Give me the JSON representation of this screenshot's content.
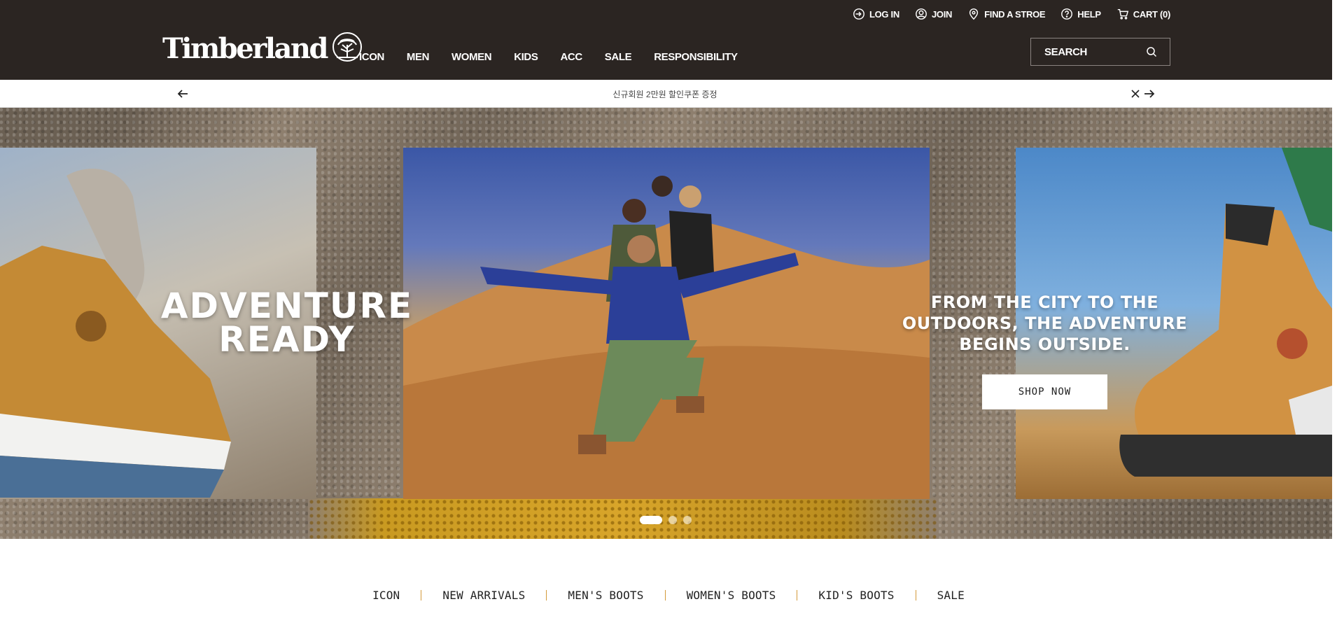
{
  "header": {
    "utility_links": [
      {
        "label": "LOG IN",
        "icon": "login-icon"
      },
      {
        "label": "JOIN",
        "icon": "user-icon"
      },
      {
        "label": "FIND A STROE",
        "icon": "location-pin-icon"
      },
      {
        "label": "HELP",
        "icon": "help-icon"
      },
      {
        "label": "CART (0)",
        "icon": "cart-icon"
      }
    ],
    "logo_text": "Timberland",
    "main_nav": [
      "ICON",
      "MEN",
      "WOMEN",
      "KIDS",
      "ACC",
      "SALE",
      "RESPONSIBILITY"
    ],
    "search": {
      "placeholder": "SEARCH"
    }
  },
  "announcement": {
    "text": "신규회원 2만원 할인쿠폰 증정"
  },
  "hero": {
    "headline_line1": "ADVENTURE",
    "headline_line2": "READY",
    "subheadline": "FROM THE CITY TO THE OUTDOORS, THE ADVENTURE BEGINS OUTSIDE.",
    "cta_label": "SHOP NOW",
    "slides_total": 3,
    "active_slide": 1
  },
  "category_nav": [
    "ICON",
    "NEW ARRIVALS",
    "MEN'S BOOTS",
    "WOMEN'S BOOTS",
    "KID'S BOOTS",
    "SALE"
  ],
  "colors": {
    "header_bg": "#2b2522",
    "white": "#ffffff",
    "separator": "#d39a3a"
  }
}
